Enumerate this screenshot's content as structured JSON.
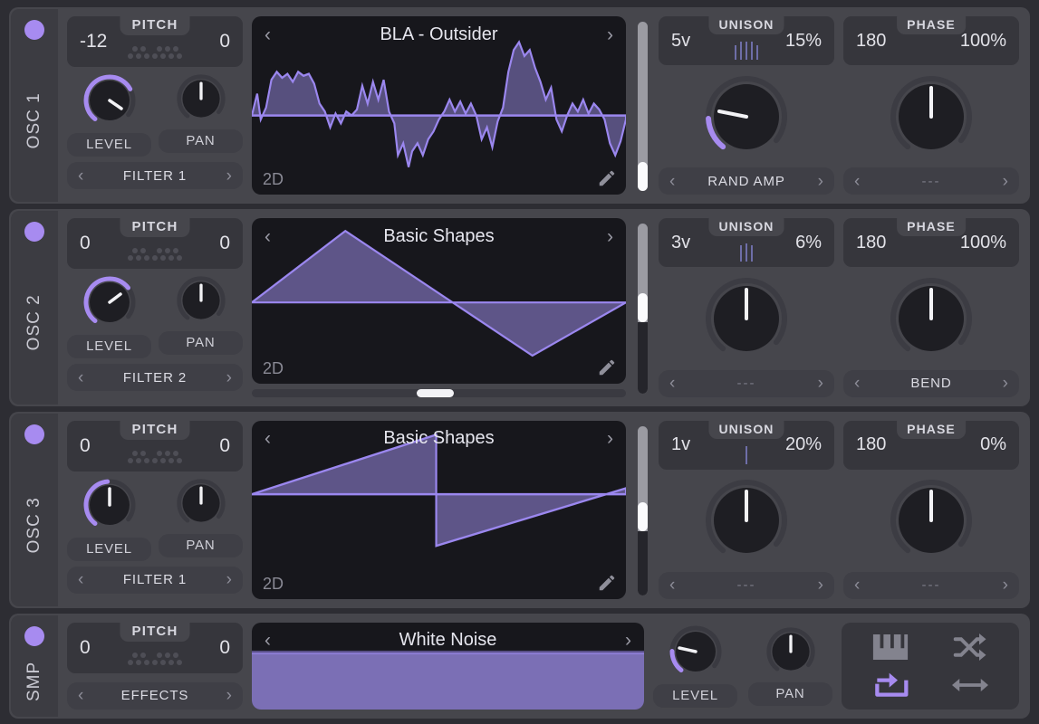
{
  "accent": "#a78bf0",
  "rows": [
    {
      "rail_label": "OSC 1",
      "pitch": {
        "caption": "PITCH",
        "left": "-12",
        "right": "0"
      },
      "level": {
        "label": "LEVEL"
      },
      "pan": {
        "label": "PAN"
      },
      "filter": {
        "label": "FILTER 1"
      },
      "wavetable": {
        "title": "BLA - Outsider",
        "view_mode": "2D"
      },
      "unison": {
        "caption": "UNISON",
        "voices": "5v",
        "amount": "15%",
        "voice_count": 5
      },
      "phase": {
        "caption": "PHASE",
        "value": "180",
        "amount": "100%"
      },
      "mod_left": {
        "label": "RAND AMP"
      },
      "mod_right": {
        "label": "---"
      }
    },
    {
      "rail_label": "OSC 2",
      "pitch": {
        "caption": "PITCH",
        "left": "0",
        "right": "0"
      },
      "level": {
        "label": "LEVEL"
      },
      "pan": {
        "label": "PAN"
      },
      "filter": {
        "label": "FILTER 2"
      },
      "wavetable": {
        "title": "Basic Shapes",
        "view_mode": "2D"
      },
      "unison": {
        "caption": "UNISON",
        "voices": "3v",
        "amount": "6%",
        "voice_count": 3
      },
      "phase": {
        "caption": "PHASE",
        "value": "180",
        "amount": "100%"
      },
      "mod_left": {
        "label": "---"
      },
      "mod_right": {
        "label": "BEND"
      }
    },
    {
      "rail_label": "OSC 3",
      "pitch": {
        "caption": "PITCH",
        "left": "0",
        "right": "0"
      },
      "level": {
        "label": "LEVEL"
      },
      "pan": {
        "label": "PAN"
      },
      "filter": {
        "label": "FILTER 1"
      },
      "wavetable": {
        "title": "Basic Shapes",
        "view_mode": "2D"
      },
      "unison": {
        "caption": "UNISON",
        "voices": "1v",
        "amount": "20%",
        "voice_count": 1
      },
      "phase": {
        "caption": "PHASE",
        "value": "180",
        "amount": "0%"
      },
      "mod_left": {
        "label": "---"
      },
      "mod_right": {
        "label": "---"
      }
    }
  ],
  "sampler": {
    "rail_label": "SMP",
    "pitch": {
      "caption": "PITCH",
      "left": "0",
      "right": "0"
    },
    "effects": {
      "label": "EFFECTS"
    },
    "sample": {
      "title": "White Noise"
    },
    "level": {
      "label": "LEVEL"
    },
    "pan": {
      "label": "PAN"
    },
    "icons": [
      {
        "name": "keyzone-icon",
        "active": false
      },
      {
        "name": "shuffle-icon",
        "active": false
      },
      {
        "name": "loop-icon",
        "active": true
      },
      {
        "name": "bidirectional-icon",
        "active": false
      }
    ]
  }
}
